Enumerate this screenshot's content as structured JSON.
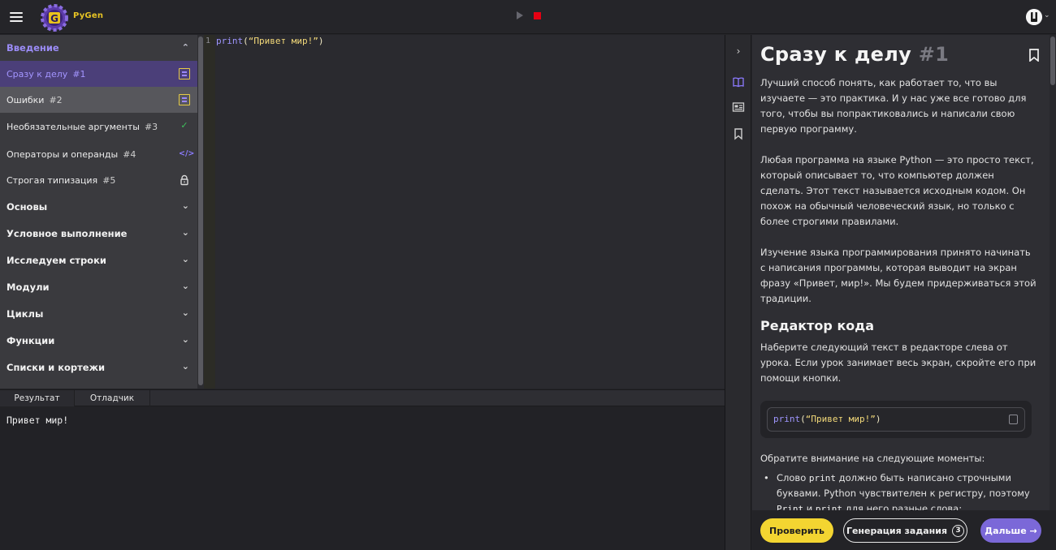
{
  "app": {
    "brand": "PyGen",
    "logo_letter": "G"
  },
  "toolbar": {
    "run_icon": "play-icon",
    "stop_icon": "stop-icon"
  },
  "sidebar": {
    "open_section": "Введение",
    "lessons": [
      {
        "title": "Сразу к делу",
        "num": "#1",
        "status": "doc-icon"
      },
      {
        "title": "Ошибки",
        "num": "#2",
        "status": "doc-icon"
      },
      {
        "title": "Необязательные аргументы",
        "num": "#3",
        "status": "check-icon",
        "status_glyph": "✓"
      },
      {
        "title": "Операторы и операнды",
        "num": "#4",
        "status": "code-icon",
        "status_glyph": "</>"
      },
      {
        "title": "Строгая типизация",
        "num": "#5",
        "status": "lock-icon"
      }
    ],
    "sections": [
      "Основы",
      "Условное выполнение",
      "Исследуем строки",
      "Модули",
      "Циклы",
      "Функции",
      "Списки и кортежи"
    ]
  },
  "editor": {
    "line_number": "1",
    "code": {
      "fn": "print",
      "open": "(",
      "str": "“Привет мир!”",
      "close": ")"
    }
  },
  "console": {
    "tabs": [
      "Результат",
      "Отладчик"
    ],
    "output": "Привет мир!"
  },
  "lesson": {
    "title": "Сразу к делу",
    "title_num": "#1",
    "p1": "Лучший способ понять, как работает то, что вы изучаете — это практика. И у нас уже все готово для того, чтобы вы попрактиковались и написали свою первую программу.",
    "p2": "Любая программа на языке Python — это просто текст, который описывает то, что компьютер должен сделать. Этот текст называется исходным кодом. Он похож на обычный человеческий язык, но только с более строгими правилами.",
    "p3": "Изучение языка программирования принято начинать с написания программы, которая выводит на экран фразу «Привет, мир!». Мы будем придерживаться этой традиции.",
    "h2": "Редактор кода",
    "p4": "Наберите следующий текст в редакторе слева от урока. Если урок занимает весь экран, скройте его при помощи кнопки.",
    "code": {
      "fn": "print",
      "open": "(",
      "str": "“Привет мир!”",
      "close": ")"
    },
    "p5": "Обратите внимание на следующие моменты:",
    "bullet1": {
      "a": "Слово ",
      "code": "print",
      "b": " должно быть написано строчными буквами. Python чувствителен к регистру, поэтому ",
      "code2": "Print",
      "c": " и ",
      "code3": "print",
      "d": " для него разные слова;"
    }
  },
  "footer": {
    "check": "Проверить",
    "generate": "Генерация задания",
    "generate_count": "3",
    "next": "Дальше →"
  }
}
